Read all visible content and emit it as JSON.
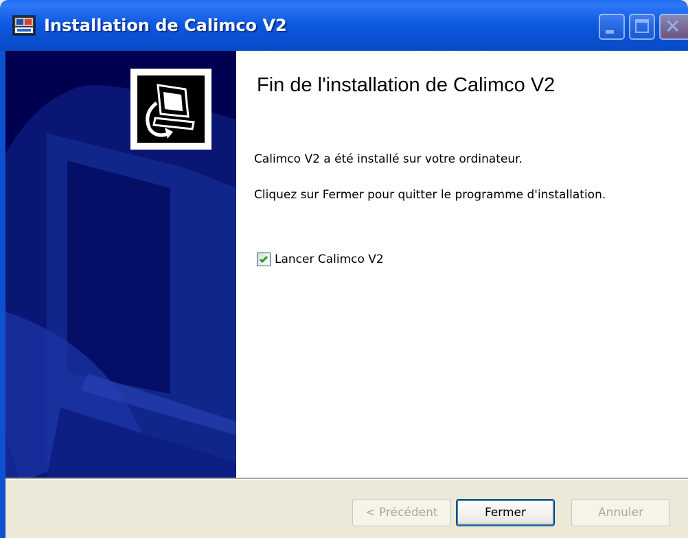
{
  "window": {
    "title": "Installation de Calimco V2",
    "title_icon": "installer-app-icon",
    "controls": {
      "minimize_icon": "minimize-icon",
      "maximize_icon": "maximize-icon",
      "close_icon": "close-icon",
      "close_glyph": "✕"
    }
  },
  "banner": {
    "logo_icon": "computer-install-icon"
  },
  "content": {
    "heading": "Fin de l'installation de Calimco V2",
    "line1": "Calimco V2 a été installé sur votre ordinateur.",
    "line2": "Cliquez sur Fermer pour quitter le programme d'installation.",
    "checkbox": {
      "label": "Lancer Calimco V2",
      "checked": true
    }
  },
  "buttons": {
    "prev_label": "< Précédent",
    "prev_enabled": false,
    "close_label": "Fermer",
    "close_enabled": true,
    "cancel_label": "Annuler",
    "cancel_enabled": false
  },
  "colors": {
    "titlebar": "#0a4fcf",
    "banner": "#000050",
    "checkmark": "#21a121"
  }
}
